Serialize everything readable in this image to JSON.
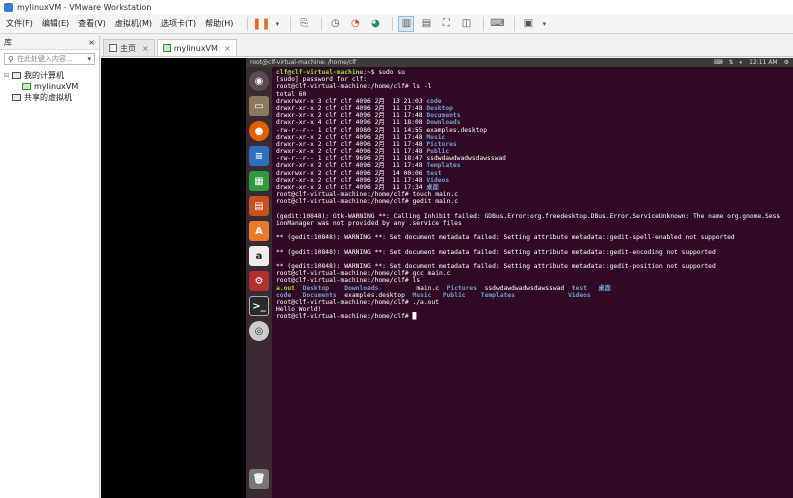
{
  "window": {
    "title": "mylinuxVM - VMware Workstation"
  },
  "menu": {
    "items": [
      "文件(F)",
      "编辑(E)",
      "查看(V)",
      "虚拟机(M)",
      "选项卡(T)",
      "帮助(H)"
    ]
  },
  "library": {
    "header": "库",
    "close_glyph": "×",
    "search_placeholder": "在此处键入内容...",
    "tree": [
      {
        "label": "我的计算机"
      },
      {
        "label": "mylinuxVM"
      },
      {
        "label": "共享的虚拟机"
      }
    ]
  },
  "tabs": [
    {
      "label": "主页"
    },
    {
      "label": "mylinuxVM"
    }
  ],
  "tab_close": "×",
  "ubuntu": {
    "window_title": "root@clf-virtual-machine: /home/clf",
    "time": "12:11 AM"
  },
  "launcher_icons": [
    "ubuntu-dash",
    "files",
    "firefox",
    "libreoffice-writer",
    "libreoffice-calc",
    "libreoffice-impress",
    "software-center",
    "amazon",
    "system-settings",
    "terminal",
    "dvd",
    "trash"
  ],
  "terminal": {
    "lines": [
      [
        {
          "t": "clf@clf-virtual-machine",
          "c": "prompt"
        },
        {
          "t": ":~$ sudo su"
        }
      ],
      [
        {
          "t": "[sudo] password for clf:"
        }
      ],
      [
        {
          "t": "root@clf-virtual-machine:/home/clf# ls -l"
        }
      ],
      [
        {
          "t": "total 60"
        }
      ],
      [
        {
          "t": "drwxrwxr-x 3 clf clf 4096 2月  13 21:03 "
        },
        {
          "t": "code",
          "c": "dir"
        }
      ],
      [
        {
          "t": "drwxr-xr-x 2 clf clf 4096 2月  11 17:48 "
        },
        {
          "t": "Desktop",
          "c": "dir"
        }
      ],
      [
        {
          "t": "drwxr-xr-x 2 clf clf 4096 2月  11 17:48 "
        },
        {
          "t": "Documents",
          "c": "dir"
        }
      ],
      [
        {
          "t": "drwxr-xr-x 4 clf clf 4096 2月  11 18:08 "
        },
        {
          "t": "Downloads",
          "c": "dir"
        }
      ],
      [
        {
          "t": "-rw-r--r-- 1 clf clf 8980 2月  11 14:55 examples.desktop"
        }
      ],
      [
        {
          "t": "drwxr-xr-x 2 clf clf 4096 2月  11 17:48 "
        },
        {
          "t": "Music",
          "c": "dir"
        }
      ],
      [
        {
          "t": "drwxr-xr-x 2 clf clf 4096 2月  11 17:48 "
        },
        {
          "t": "Pictures",
          "c": "dir"
        }
      ],
      [
        {
          "t": "drwxr-xr-x 2 clf clf 4096 2月  11 17:48 "
        },
        {
          "t": "Public",
          "c": "dir"
        }
      ],
      [
        {
          "t": "-rw-r--r-- 1 clf clf 9696 2月  11 18:47 ssdwdawdwadwsdawsswad"
        }
      ],
      [
        {
          "t": "drwxr-xr-x 2 clf clf 4096 2月  11 17:48 "
        },
        {
          "t": "Templates",
          "c": "dir"
        }
      ],
      [
        {
          "t": "drwxrwxr-x 2 clf clf 4096 2月  14 00:06 "
        },
        {
          "t": "test",
          "c": "dir"
        }
      ],
      [
        {
          "t": "drwxr-xr-x 2 clf clf 4096 2月  11 17:48 "
        },
        {
          "t": "Videos",
          "c": "dir"
        }
      ],
      [
        {
          "t": "drwxr-xr-x 2 clf clf 4096 2月  11 17:34 "
        },
        {
          "t": "桌面",
          "c": "dir"
        }
      ],
      [
        {
          "t": "root@clf-virtual-machine:/home/clf# touch main.c"
        }
      ],
      [
        {
          "t": "root@clf-virtual-machine:/home/clf# gedit main.c"
        }
      ],
      [
        {
          "t": ""
        }
      ],
      [
        {
          "t": "(gedit:10848): Gtk-WARNING **: Calling Inhibit failed: GDBus.Error:org.freedesktop.DBus.Error.ServiceUnknown: The name org.gnome.Sess"
        }
      ],
      [
        {
          "t": "ionManager was not provided by any .service files"
        }
      ],
      [
        {
          "t": ""
        }
      ],
      [
        {
          "t": "** (gedit:10848): WARNING **: Set document metadata failed: Setting attribute metadata::gedit-spell-enabled not supported"
        }
      ],
      [
        {
          "t": ""
        }
      ],
      [
        {
          "t": "** (gedit:10848): WARNING **: Set document metadata failed: Setting attribute metadata::gedit-encoding not supported"
        }
      ],
      [
        {
          "t": ""
        }
      ],
      [
        {
          "t": "** (gedit:10848): WARNING **: Set document metadata failed: Setting attribute metadata::gedit-position not supported"
        }
      ],
      [
        {
          "t": "root@clf-virtual-machine:/home/clf# gcc main.c"
        }
      ],
      [
        {
          "t": "root@clf-virtual-machine:/home/clf# ls"
        }
      ],
      [
        {
          "t": "a.out",
          "c": "exe"
        },
        {
          "t": "  "
        },
        {
          "t": "Desktop",
          "c": "dir"
        },
        {
          "t": "    "
        },
        {
          "t": "Downloads",
          "c": "dir"
        },
        {
          "t": "          main.c  "
        },
        {
          "t": "Pictures",
          "c": "dir"
        },
        {
          "t": "  ssdwdawdwadwsdawsswad  "
        },
        {
          "t": "test",
          "c": "dir"
        },
        {
          "t": "   "
        },
        {
          "t": "桌面",
          "c": "dir"
        }
      ],
      [
        {
          "t": "code",
          "c": "dir"
        },
        {
          "t": "   "
        },
        {
          "t": "Documents",
          "c": "dir"
        },
        {
          "t": "  examples.desktop  "
        },
        {
          "t": "Music",
          "c": "dir"
        },
        {
          "t": "   "
        },
        {
          "t": "Public",
          "c": "dir"
        },
        {
          "t": "    "
        },
        {
          "t": "Templates",
          "c": "dir"
        },
        {
          "t": "              "
        },
        {
          "t": "Videos",
          "c": "dir"
        }
      ],
      [
        {
          "t": "root@clf-virtual-machine:/home/clf# ./a.out"
        }
      ],
      [
        {
          "t": "Hello World!"
        }
      ],
      [
        {
          "t": "root@clf-virtual-machine:/home/clf# "
        },
        {
          "t": "█"
        }
      ]
    ]
  }
}
